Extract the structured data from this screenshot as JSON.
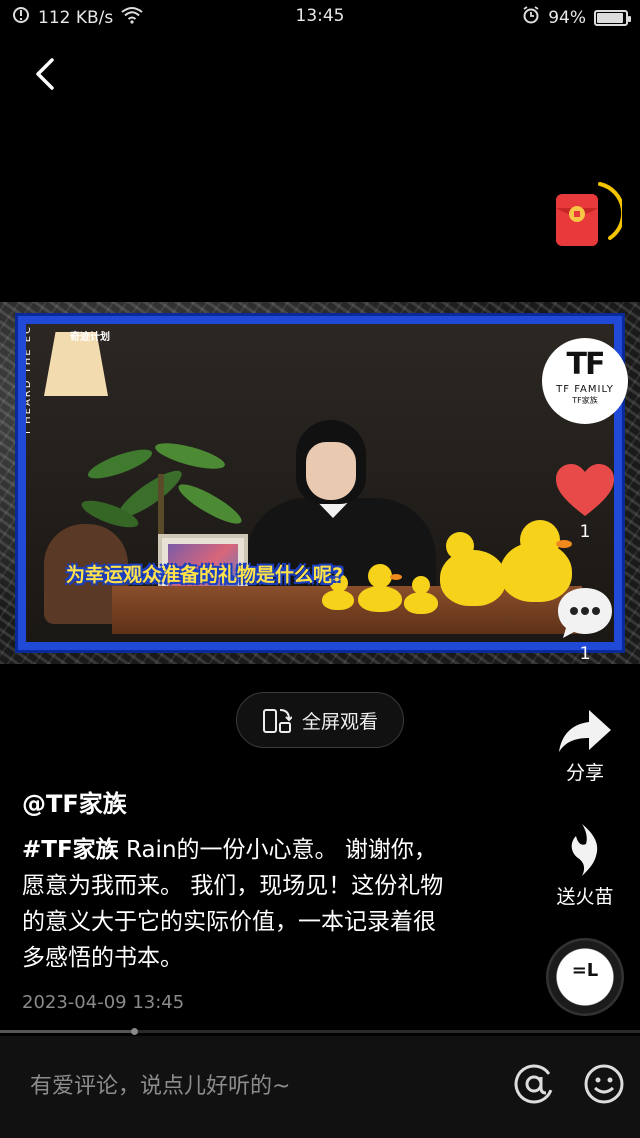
{
  "status_bar": {
    "network_speed": "112 KB/s",
    "time": "13:45",
    "battery": "94%",
    "battery_level": 0.94
  },
  "nav": {
    "back_icon": "chevron-left-icon"
  },
  "video": {
    "frame_label": "奇迹计划",
    "side_text": "I HEARD THE ECHO",
    "caption": "为幸运观众准备的礼物是什么呢?"
  },
  "channel_logo": {
    "mark": "TF",
    "name": "TF FAMILY",
    "sub": "TF家族"
  },
  "actions": {
    "like_count": "1",
    "comment_count": "1",
    "share_label": "分享",
    "fire_label": "送火苗"
  },
  "fullscreen": {
    "label": "全屏观看"
  },
  "post": {
    "author": "@TF家族",
    "hashtag": "#TF家族",
    "text": " Rain的一份小心意。 谢谢你，愿意为我而来。 我们，现场见！这份礼物的意义大于它的实际价值，一本记录着很多感悟的书本。",
    "timestamp": "2023-04-09 13:45"
  },
  "disc": {
    "label": "=L"
  },
  "playback": {
    "progress": 0.21
  },
  "comment_bar": {
    "placeholder": "有爱评论，说点儿好听的~"
  },
  "colors": {
    "accent_red": "#e84a4a",
    "frame_blue": "#1f49d6",
    "caption_yellow": "#ffe24a"
  }
}
